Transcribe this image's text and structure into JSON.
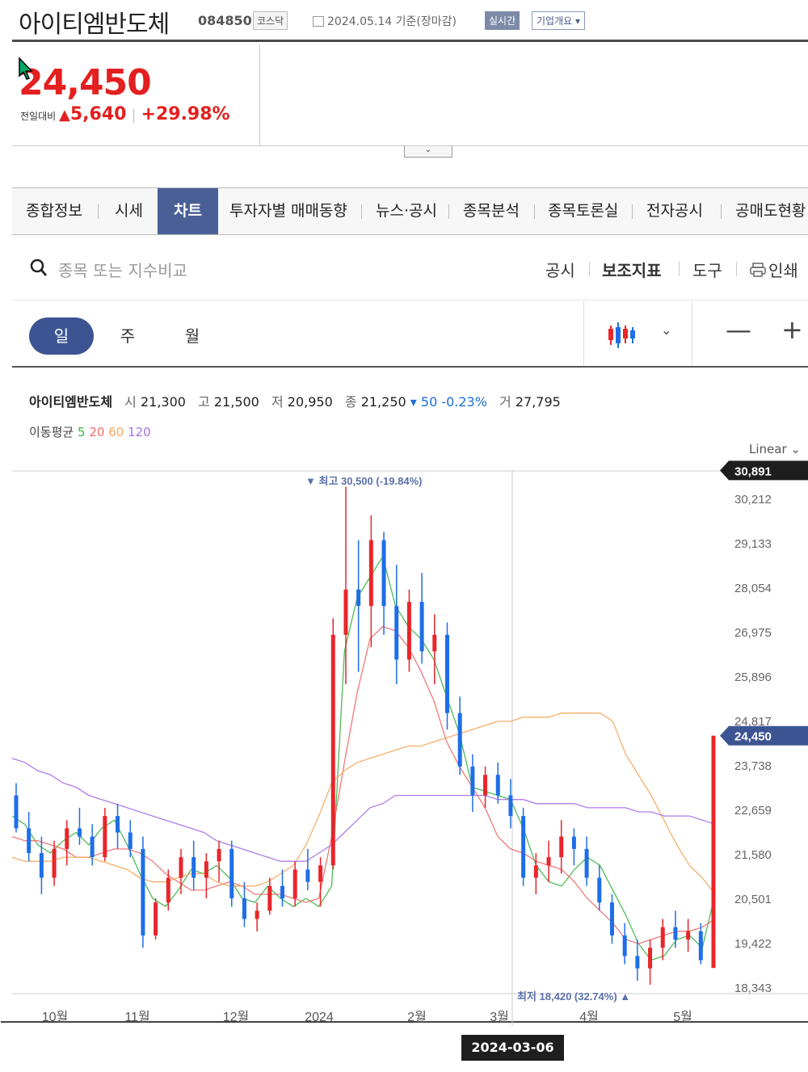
{
  "header": {
    "name": "아이티엠반도체",
    "code": "084850",
    "market": "코스닥",
    "date": "2024.05.14 기준(장마감)",
    "realtime": "실시간",
    "company": "기업개요 ▾"
  },
  "price": {
    "current": "24,450",
    "label": "전일대비",
    "arrow": "▲",
    "change": "5,640",
    "rate": "+29.98%"
  },
  "expand_icon": "⌄",
  "tabs": [
    "종합정보",
    "시세",
    "차트",
    "투자자별 매매동향",
    "뉴스·공시",
    "종목분석",
    "종목토론실",
    "전자공시",
    "공매도현황"
  ],
  "search": {
    "placeholder": "종목 또는 지수비교"
  },
  "tools": [
    "공시",
    "보조지표",
    "도구",
    "인쇄"
  ],
  "periods": [
    "일",
    "주",
    "월"
  ],
  "zoom": {
    "out": "—",
    "in": "+"
  },
  "ohlc": {
    "name": "아이티엠반도체",
    "open_label": "시",
    "open": "21,300",
    "high_label": "고",
    "high": "21,500",
    "low_label": "저",
    "low": "20,950",
    "close_label": "종",
    "close": "21,250",
    "diff": "▾ 50 -0.23%",
    "vol_label": "거",
    "vol": "27,795"
  },
  "ma": {
    "label": "이동평균",
    "p5": "5",
    "p20": "20",
    "p60": "60",
    "p120": "120"
  },
  "scale": "Linear",
  "crosshair_date": "2024-03-06",
  "chart_data": {
    "type": "candlestick",
    "y_ticks": [
      30212,
      29133,
      28054,
      26975,
      25896,
      24817,
      23738,
      22659,
      21580,
      20501,
      19422,
      18343
    ],
    "y_tick_labels": [
      "30,212",
      "29,133",
      "28,054",
      "26,975",
      "25,896",
      "24,817",
      "23,738",
      "22,659",
      "21,580",
      "20,501",
      "19,422",
      "18,343"
    ],
    "ylim": [
      18000,
      31000
    ],
    "x_ticks": [
      "10월",
      "11월",
      "12월",
      "2024",
      "2월",
      "3월",
      "4월",
      "5월"
    ],
    "cursor_price": "30,891",
    "last_price": "24,450",
    "high_annotation": "▼ 최고 30,500 (-19.84%)",
    "low_annotation": "최저 18,420 (32.74%) ▲",
    "colors": {
      "up": "#e8262b",
      "down": "#1e6ee8",
      "ma5": "#3cb444",
      "ma20": "#f06a6a",
      "ma60": "#f5a65b",
      "ma120": "#a86ee8"
    },
    "series": [
      {
        "name": "5",
        "values": [
          22500,
          22300,
          21800,
          21600,
          21900,
          22100,
          21800,
          22200,
          22400,
          21800,
          21100,
          20500,
          20300,
          20700,
          21200,
          21100,
          21300,
          21000,
          20500,
          20400,
          20800,
          20500,
          20300,
          20500,
          20300,
          20800,
          26500,
          27800,
          28300,
          28800,
          27600,
          27100,
          26800,
          26300,
          25400,
          24500,
          23200,
          23100,
          23000,
          22900,
          22200,
          21300,
          20900,
          20800,
          21200,
          21500,
          21300,
          20700,
          20100,
          19400,
          19000,
          19100,
          19500,
          19600,
          19300,
          20600
        ]
      },
      {
        "name": "20",
        "values": [
          22000,
          21900,
          21900,
          21800,
          21700,
          21500,
          21500,
          21600,
          21700,
          21700,
          21600,
          21400,
          21100,
          20900,
          20700,
          20700,
          20800,
          20900,
          20800,
          20600,
          20600,
          20600,
          20500,
          20400,
          20500,
          22000,
          23800,
          25500,
          26800,
          27100,
          27000,
          26600,
          26000,
          25300,
          24300,
          23700,
          23200,
          22700,
          22000,
          21700,
          21600,
          21400,
          21300,
          21200,
          20900,
          20500,
          20200,
          19900,
          19500,
          19400,
          19500,
          19600,
          19700,
          19700,
          19800,
          20000
        ]
      },
      {
        "name": "60",
        "values": [
          21500,
          21400,
          21400,
          21400,
          21500,
          21500,
          21500,
          21400,
          21300,
          21200,
          21000,
          20900,
          20900,
          21000,
          21100,
          21100,
          20900,
          20800,
          20800,
          20800,
          20900,
          21100,
          21300,
          21800,
          22500,
          23300,
          23600,
          23800,
          23900,
          24000,
          24100,
          24200,
          24200,
          24300,
          24400,
          24500,
          24600,
          24700,
          24800,
          24800,
          24900,
          24900,
          24900,
          25000,
          25000,
          25000,
          25000,
          24800,
          24000,
          23500,
          23000,
          22400,
          21800,
          21300,
          21000,
          20600
        ]
      },
      {
        "name": "120",
        "values": [
          23900,
          23800,
          23600,
          23500,
          23300,
          23200,
          23000,
          22900,
          22800,
          22700,
          22600,
          22500,
          22400,
          22300,
          22200,
          22100,
          21900,
          21800,
          21700,
          21600,
          21500,
          21400,
          21400,
          21400,
          21600,
          21800,
          22100,
          22400,
          22700,
          22800,
          23000,
          23000,
          23000,
          23000,
          23000,
          23000,
          23000,
          23000,
          22900,
          22900,
          22900,
          22800,
          22800,
          22800,
          22800,
          22700,
          22700,
          22700,
          22700,
          22600,
          22600,
          22500,
          22500,
          22500,
          22400,
          22300
        ]
      }
    ],
    "candles": [
      {
        "o": 23000,
        "h": 23300,
        "l": 22100,
        "c": 22200
      },
      {
        "o": 22200,
        "h": 22600,
        "l": 21400,
        "c": 21600
      },
      {
        "o": 21600,
        "h": 22000,
        "l": 20600,
        "c": 21000
      },
      {
        "o": 21000,
        "h": 21900,
        "l": 20800,
        "c": 21700
      },
      {
        "o": 21700,
        "h": 22400,
        "l": 21300,
        "c": 22200
      },
      {
        "o": 22200,
        "h": 22700,
        "l": 21800,
        "c": 22000
      },
      {
        "o": 22000,
        "h": 22300,
        "l": 21300,
        "c": 21500
      },
      {
        "o": 21500,
        "h": 22700,
        "l": 21400,
        "c": 22500
      },
      {
        "o": 22500,
        "h": 22800,
        "l": 21700,
        "c": 22100
      },
      {
        "o": 22100,
        "h": 22400,
        "l": 21500,
        "c": 21700
      },
      {
        "o": 21700,
        "h": 22000,
        "l": 19300,
        "c": 19600
      },
      {
        "o": 19600,
        "h": 20500,
        "l": 19500,
        "c": 20400
      },
      {
        "o": 20400,
        "h": 21200,
        "l": 20200,
        "c": 21000
      },
      {
        "o": 21000,
        "h": 21700,
        "l": 20600,
        "c": 21500
      },
      {
        "o": 21500,
        "h": 21900,
        "l": 20700,
        "c": 21000
      },
      {
        "o": 21000,
        "h": 21600,
        "l": 20500,
        "c": 21400
      },
      {
        "o": 21400,
        "h": 21900,
        "l": 20900,
        "c": 21700
      },
      {
        "o": 21700,
        "h": 21900,
        "l": 20300,
        "c": 20500
      },
      {
        "o": 20500,
        "h": 20900,
        "l": 19800,
        "c": 20000
      },
      {
        "o": 20000,
        "h": 20400,
        "l": 19700,
        "c": 20200
      },
      {
        "o": 20200,
        "h": 21000,
        "l": 20100,
        "c": 20800
      },
      {
        "o": 20800,
        "h": 21200,
        "l": 20300,
        "c": 20500
      },
      {
        "o": 20500,
        "h": 21400,
        "l": 20300,
        "c": 21200
      },
      {
        "o": 21200,
        "h": 21700,
        "l": 20700,
        "c": 20900
      },
      {
        "o": 20900,
        "h": 21500,
        "l": 20300,
        "c": 21300
      },
      {
        "o": 21300,
        "h": 27300,
        "l": 21200,
        "c": 26900
      },
      {
        "o": 26900,
        "h": 30500,
        "l": 25700,
        "c": 28000
      },
      {
        "o": 28000,
        "h": 29200,
        "l": 26000,
        "c": 27600
      },
      {
        "o": 27600,
        "h": 29800,
        "l": 26600,
        "c": 29200
      },
      {
        "o": 29200,
        "h": 29400,
        "l": 26900,
        "c": 27600
      },
      {
        "o": 27600,
        "h": 28600,
        "l": 25700,
        "c": 26300
      },
      {
        "o": 26300,
        "h": 28000,
        "l": 26000,
        "c": 27700
      },
      {
        "o": 27700,
        "h": 28400,
        "l": 26200,
        "c": 26500
      },
      {
        "o": 26500,
        "h": 27400,
        "l": 25700,
        "c": 26900
      },
      {
        "o": 26900,
        "h": 27200,
        "l": 24600,
        "c": 25000
      },
      {
        "o": 25000,
        "h": 25400,
        "l": 23500,
        "c": 23700
      },
      {
        "o": 23700,
        "h": 24000,
        "l": 22600,
        "c": 23000
      },
      {
        "o": 23000,
        "h": 23700,
        "l": 22700,
        "c": 23500
      },
      {
        "o": 23500,
        "h": 23800,
        "l": 22800,
        "c": 23000
      },
      {
        "o": 23000,
        "h": 23400,
        "l": 22200,
        "c": 22500
      },
      {
        "o": 22500,
        "h": 22700,
        "l": 20800,
        "c": 21000
      },
      {
        "o": 21000,
        "h": 21600,
        "l": 20600,
        "c": 21300
      },
      {
        "o": 21300,
        "h": 21900,
        "l": 20900,
        "c": 21500
      },
      {
        "o": 21500,
        "h": 22400,
        "l": 21100,
        "c": 22000
      },
      {
        "o": 22000,
        "h": 22200,
        "l": 21300,
        "c": 21700
      },
      {
        "o": 21700,
        "h": 22000,
        "l": 20800,
        "c": 21000
      },
      {
        "o": 21000,
        "h": 21300,
        "l": 20200,
        "c": 20400
      },
      {
        "o": 20400,
        "h": 20600,
        "l": 19400,
        "c": 19600
      },
      {
        "o": 19600,
        "h": 19900,
        "l": 18900,
        "c": 19100
      },
      {
        "o": 19100,
        "h": 19500,
        "l": 18500,
        "c": 18800
      },
      {
        "o": 18800,
        "h": 19500,
        "l": 18400,
        "c": 19300
      },
      {
        "o": 19300,
        "h": 20000,
        "l": 19000,
        "c": 19800
      },
      {
        "o": 19800,
        "h": 20200,
        "l": 19300,
        "c": 19500
      },
      {
        "o": 19500,
        "h": 20000,
        "l": 19200,
        "c": 19700
      },
      {
        "o": 19700,
        "h": 19900,
        "l": 18900,
        "c": 19000
      },
      {
        "o": 18810,
        "h": 24450,
        "l": 18810,
        "c": 24450
      }
    ]
  }
}
